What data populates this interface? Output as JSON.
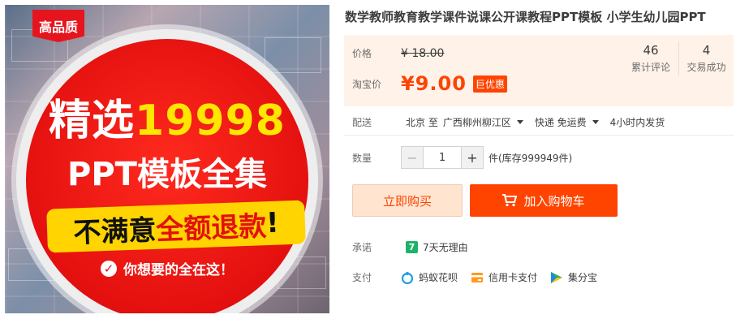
{
  "product_image": {
    "badge": "高品质",
    "line1_prefix": "精选",
    "line1_number": "19998",
    "line2": "PPT模板全集",
    "banner_black1": "不满意",
    "banner_red": "全额退款",
    "banner_black2": "!",
    "check_text": "你想要的全在这！"
  },
  "title": "数学教师教育教学课件说课公开课教程PPT模板 小学生幼儿园PPT",
  "price": {
    "label": "价格",
    "value": "¥ 18.00"
  },
  "promo": {
    "label": "淘宝价",
    "value": "¥9.00",
    "tag": "巨优惠"
  },
  "stats": [
    {
      "number": "46",
      "label": "累计评论"
    },
    {
      "number": "4",
      "label": "交易成功"
    }
  ],
  "delivery": {
    "label": "配送",
    "from": "北京 至",
    "to": "广西柳州柳江区",
    "shipping": "快递 免运费",
    "dispatch": "4小时内发货"
  },
  "quantity": {
    "label": "数量",
    "value": "1",
    "minus": "−",
    "plus": "+",
    "stock": "件(库存999949件)"
  },
  "buttons": {
    "buy_now": "立即购买",
    "add_cart": "加入购物车"
  },
  "promise": {
    "label": "承诺",
    "icon_text": "7",
    "text": "7天无理由"
  },
  "payment": {
    "label": "支付",
    "methods": [
      {
        "name": "蚂蚁花呗",
        "icon": "huabei-icon",
        "color": "#1e9ee8"
      },
      {
        "name": "信用卡支付",
        "icon": "credit-card-icon",
        "color": "#ff9a1f"
      },
      {
        "name": "集分宝",
        "icon": "jifenbao-icon",
        "color": "#2fb24c"
      }
    ]
  },
  "colors": {
    "accent": "#ff4400",
    "price_bg": "#fff2e8",
    "image_red": "#e3100f",
    "image_yellow": "#ffe600"
  }
}
